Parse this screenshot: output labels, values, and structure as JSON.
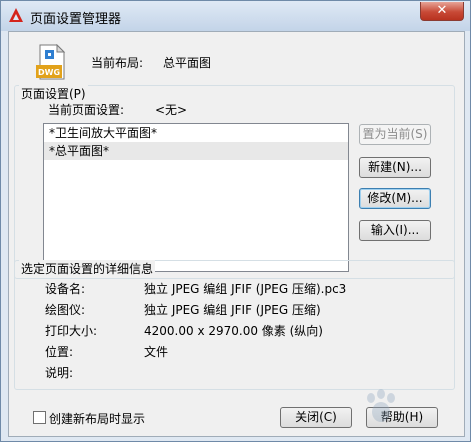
{
  "window": {
    "title": "页面设置管理器",
    "close_glyph": "✕"
  },
  "layout": {
    "label": "当前布局:",
    "value": "总平面图"
  },
  "page_setup": {
    "group_label": "页面设置(P)",
    "current_label": "当前页面设置:",
    "current_value": "<无>",
    "items": [
      {
        "label": "*卫生间放大平面图*"
      },
      {
        "label": "*总平面图*"
      }
    ],
    "buttons": {
      "set_current": "置为当前(S)",
      "new": "新建(N)...",
      "modify": "修改(M)...",
      "import": "输入(I)..."
    }
  },
  "details": {
    "group_label": "选定页面设置的详细信息",
    "rows": [
      {
        "label": "设备名:",
        "value": "独立 JPEG 编组 JFIF (JPEG 压缩).pc3"
      },
      {
        "label": "绘图仪:",
        "value": "独立 JPEG 编组 JFIF (JPEG 压缩)"
      },
      {
        "label": "打印大小:",
        "value": "4200.00 x 2970.00 像素 (纵向)"
      },
      {
        "label": "位置:",
        "value": "文件"
      },
      {
        "label": "说明:",
        "value": ""
      }
    ]
  },
  "footer": {
    "checkbox_label": "创建新布局时显示",
    "checkbox_checked": false,
    "close_button": "关闭(C)",
    "help_button": "帮助(H)"
  },
  "icons": {
    "app": "autocad-a-icon",
    "file": "dwg-file-icon"
  },
  "colors": {
    "app_icon_red": "#d4241c",
    "close_button": "#c84a37",
    "focus_border": "#3c7fb1"
  }
}
